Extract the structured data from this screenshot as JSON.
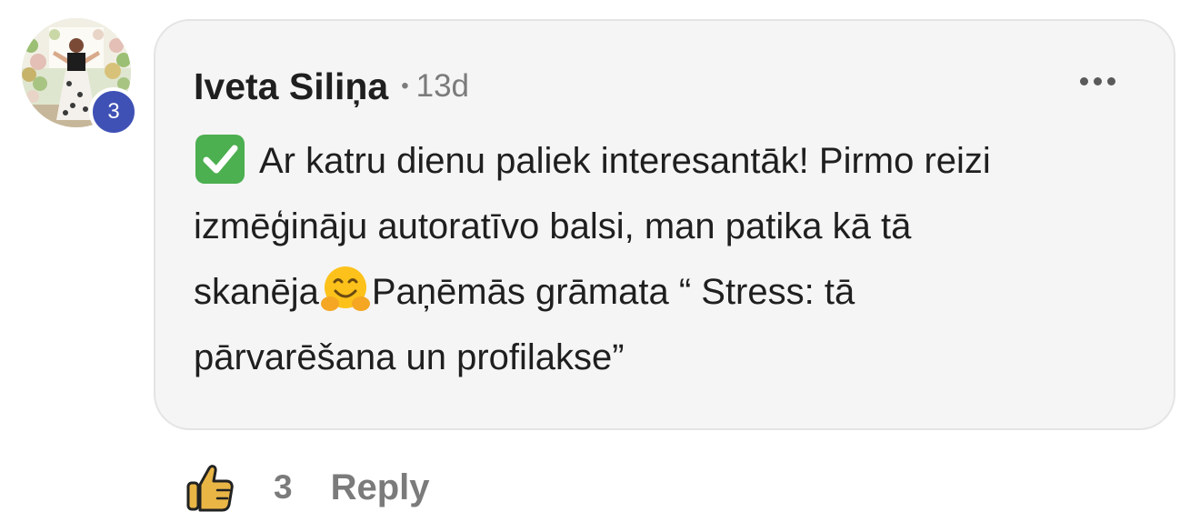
{
  "comment": {
    "author": "Iveta Siliņa",
    "separator": "•",
    "time": "13d",
    "badge_count": "3",
    "body_line1_rest": "Ar katru dienu paliek interesantāk! Pirmo reizi",
    "body_line2": "izmēģināju autoratīvo balsi, man patika kā tā",
    "body_line3_start": "skanēja",
    "body_line3_end": "Paņēmās grāmata “ Stress: tā",
    "body_line4": "pārvarēšana un profilakse”",
    "emojis": [
      "check-mark-button-icon",
      "hugging-face-icon"
    ]
  },
  "actions": {
    "like_count": "3",
    "reply_label": "Reply"
  },
  "colors": {
    "bubble_bg": "#f5f5f5",
    "badge_bg": "#3f51b5",
    "muted_text": "#7b7b7b",
    "like_icon": "#e9b646"
  }
}
